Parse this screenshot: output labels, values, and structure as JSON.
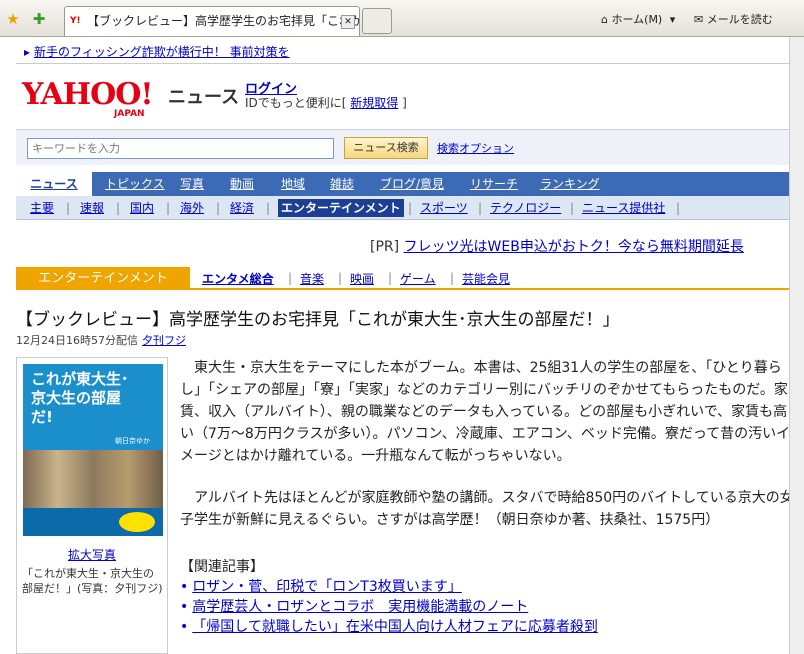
{
  "browser": {
    "tab_title": "【ブックレビュー】高学歴学生のお宅拝見「これが東大生…",
    "home_label": "ホーム(M)",
    "mail_label": "メールを読む"
  },
  "alert": {
    "text": "新手のフィッシング詐欺が横行中！ 事前対策を"
  },
  "header": {
    "logo": "YAHOO!",
    "logo_sub": "JAPAN",
    "site_name": "ニュース",
    "login": "ログイン",
    "id_prefix": "IDでもっと便利に",
    "register": "新規取得"
  },
  "search": {
    "placeholder": "キーワードを入力",
    "button": "ニュース検索",
    "options": "検索オプション"
  },
  "nav1": [
    "ニュース",
    "トピックス",
    "写真",
    "動画",
    "地域",
    "雑誌",
    "ブログ/意見",
    "リサーチ",
    "ランキング"
  ],
  "nav2": [
    "主要",
    "速報",
    "国内",
    "海外",
    "経済",
    "エンターテインメント",
    "スポーツ",
    "テクノロジー",
    "ニュース提供社"
  ],
  "pr": {
    "tag": "[PR]",
    "text": "フレッツ光はWEB申込がおトク！今なら無料期間延長"
  },
  "category": {
    "label": "エンターテインメント",
    "items": [
      "エンタメ総合",
      "音楽",
      "映画",
      "ゲーム",
      "芸能会見"
    ]
  },
  "article": {
    "headline": "【ブックレビュー】高学歴学生のお宅拝見「これが東大生･京大生の部屋だ！」",
    "date": "12月24日16時57分配信",
    "source": "夕刊フジ",
    "paragraph1": "東大生・京大生をテーマにした本がブーム。本書は、25組31人の学生の部屋を、「ひとり暮らし」「シェアの部屋」「寮」「実家」などのカテゴリー別にバッチリのぞかせてもらったものだ。家賃、収入（アルバイト）、親の職業などのデータも入っている。どの部屋も小ぎれいで、家賃も高い（7万～8万円クラスが多い）。パソコン、冷蔵庫、エアコン、ベッド完備。寮だって昔の汚いイメージとはかけ離れている。一升瓶なんて転がっちゃいない。",
    "paragraph2": "アルバイト先はほとんどが家庭教師や塾の講師。スタバで時給850円のバイトしている京大の女子学生が新鮮に見えるぐらい。さすがは高学歴！（朝日奈ゆか著、扶桑社、1575円）"
  },
  "photo": {
    "cover_title": "これが東大生･京大生の部屋だ!",
    "cover_author": "朝日奈ゆか",
    "enlarge": "拡大写真",
    "caption": "「これが東大生・京大生の部屋だ！」(写真：夕刊フジ)"
  },
  "related": {
    "heading": "【関連記事】",
    "items": [
      "ロザン・菅、印税で「ロンT3枚買います」",
      "高学歴芸人・ロザンとコラボ　実用機能満載のノート",
      "「帰国して就職したい」在米中国人向け人材フェアに応募者殺到"
    ]
  },
  "colors": {
    "yahoo_red": "#e60012",
    "nav_blue": "#3d6ab5",
    "category_orange": "#f0a400",
    "link": "#0000cc"
  }
}
